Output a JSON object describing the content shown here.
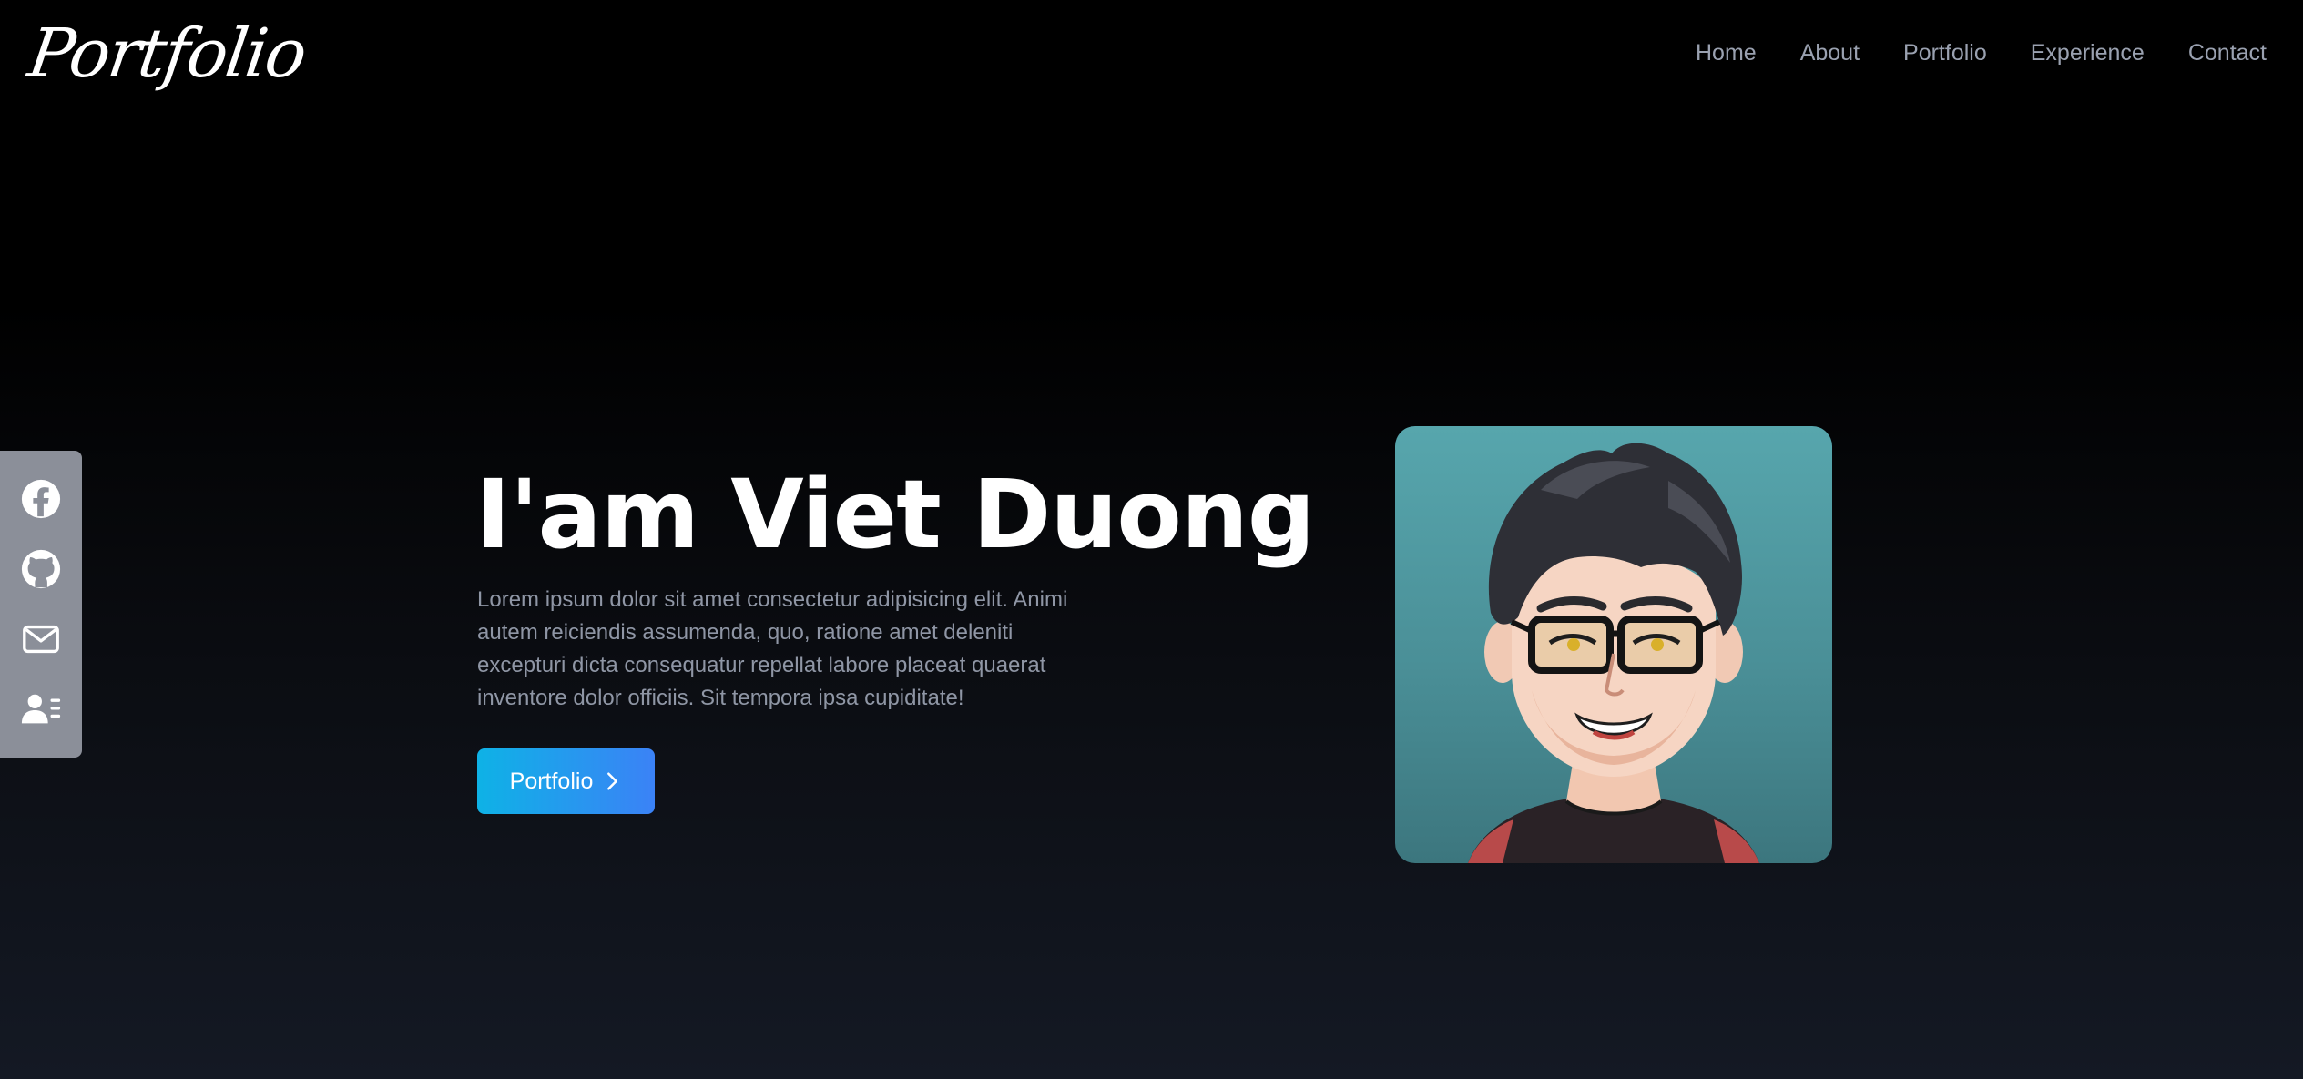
{
  "header": {
    "logo": "Portfolio",
    "nav": [
      {
        "label": "Home"
      },
      {
        "label": "About"
      },
      {
        "label": "Portfolio"
      },
      {
        "label": "Experience"
      },
      {
        "label": "Contact"
      }
    ]
  },
  "social": {
    "items": [
      {
        "icon": "facebook-icon"
      },
      {
        "icon": "github-icon"
      },
      {
        "icon": "mail-icon"
      },
      {
        "icon": "resume-icon"
      }
    ]
  },
  "hero": {
    "title": "I'am Viet Duong",
    "description": "Lorem ipsum dolor sit amet consectetur adipisicing elit. Animi autem reiciendis assumenda, quo, ratione amet deleniti excepturi dicta consequatur repellat labore placeat quaerat inventore dolor officiis. Sit tempora ipsa cupiditate!",
    "cta_label": "Portfolio"
  },
  "colors": {
    "accent_start": "#0eb2e6",
    "accent_end": "#3b82f6",
    "sidebar": "#8b8f99",
    "nav_text": "#9aa1b0"
  }
}
